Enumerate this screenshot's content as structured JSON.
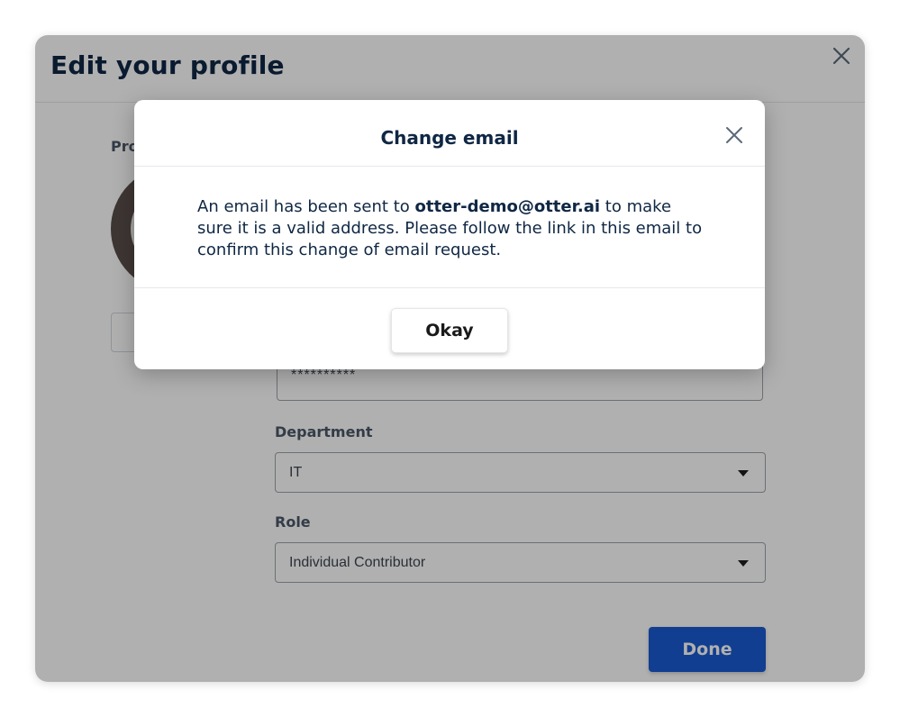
{
  "profile": {
    "title": "Edit your profile",
    "photo_label": "Pro",
    "password_value": "**********",
    "department_label": "Department",
    "department_value": "IT",
    "role_label": "Role",
    "role_value": "Individual Contributor",
    "done_label": "Done"
  },
  "dialog": {
    "title": "Change email",
    "body_prefix": "An email has been sent to ",
    "email": "otter-demo@otter.ai",
    "body_suffix": " to make sure it is a valid address. Please follow the link in this email to confirm this change of email request.",
    "okay_label": "Okay"
  },
  "icons": {
    "panel_close": "close-icon",
    "dialog_close": "close-icon",
    "select_caret": "caret-down-icon"
  },
  "colors": {
    "primary": "#1a5ad1",
    "heading": "#0f2744",
    "overlay": "rgba(0,0,0,0.31)"
  }
}
